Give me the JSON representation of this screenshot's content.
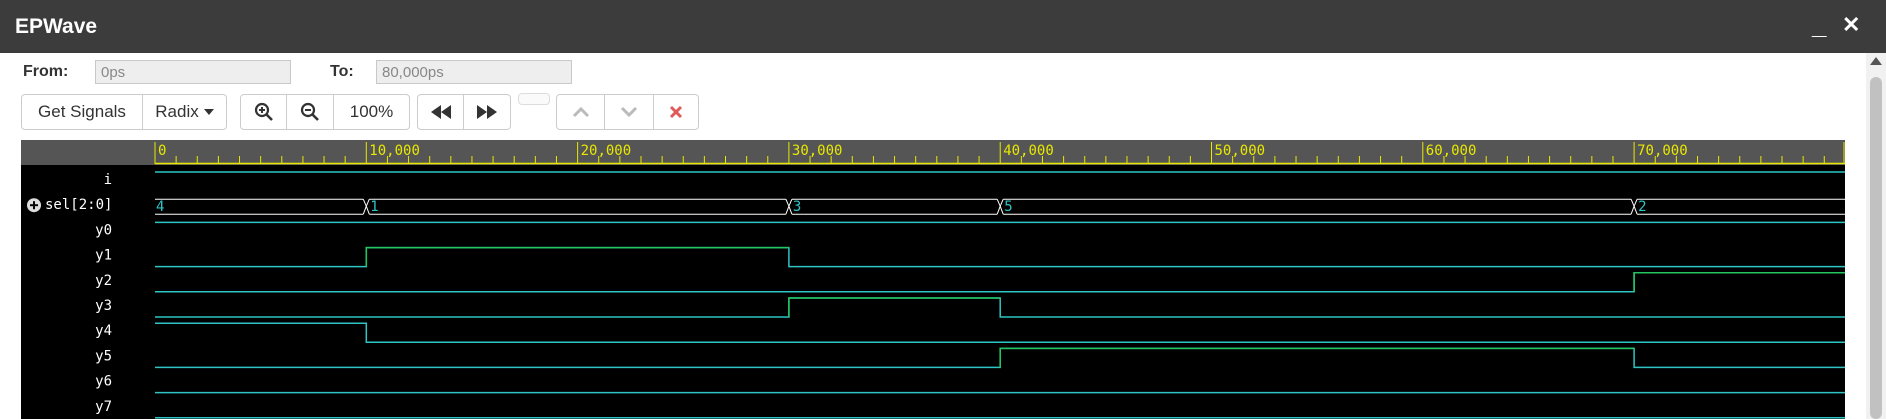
{
  "window": {
    "title": "EPWave",
    "minimize_label": "_",
    "close_label": "✕"
  },
  "range": {
    "from_label": "From:",
    "from_value": "0ps",
    "to_label": "To:",
    "to_value": "80,000ps"
  },
  "toolbar": {
    "get_signals": "Get Signals",
    "radix": "Radix",
    "zoom_in_icon": "zoom-in-icon",
    "zoom_out_icon": "zoom-out-icon",
    "zoom_level": "100%",
    "rewind_icon": "fast-backward-icon",
    "forward_icon": "fast-forward-icon",
    "prev_icon": "chevron-up-icon",
    "next_icon": "chevron-down-icon",
    "delete_icon": "times-icon"
  },
  "colors": {
    "signal": "#2ec4c4",
    "high_edge": "#22c55e",
    "ruler": "#e8e800",
    "bus": "#ffffff",
    "value": "#2ec4c4"
  },
  "ruler": {
    "ticks": [
      "0",
      "10,000",
      "20,000",
      "30,000",
      "40,000",
      "50,000",
      "60,000",
      "70,000"
    ]
  },
  "signals": [
    {
      "name": "i",
      "type": "bit",
      "changes": [
        [
          0,
          1
        ]
      ]
    },
    {
      "name": "sel[2:0]",
      "type": "bus",
      "expand_icon": "plus-circle-icon",
      "segments": [
        {
          "t": 0,
          "label": "4"
        },
        {
          "t": 10000,
          "label": "1"
        },
        {
          "t": 30000,
          "label": "3"
        },
        {
          "t": 40000,
          "label": "5"
        },
        {
          "t": 70000,
          "label": "2"
        }
      ]
    },
    {
      "name": "y0",
      "type": "bit",
      "changes": [
        [
          0,
          1
        ]
      ]
    },
    {
      "name": "y1",
      "type": "bit",
      "changes": [
        [
          0,
          0
        ],
        [
          10000,
          1
        ],
        [
          30000,
          0
        ]
      ]
    },
    {
      "name": "y2",
      "type": "bit",
      "changes": [
        [
          0,
          0
        ],
        [
          70000,
          1
        ]
      ]
    },
    {
      "name": "y3",
      "type": "bit",
      "changes": [
        [
          0,
          0
        ],
        [
          30000,
          1
        ],
        [
          40000,
          0
        ]
      ]
    },
    {
      "name": "y4",
      "type": "bit",
      "changes": [
        [
          0,
          1
        ],
        [
          10000,
          0
        ]
      ]
    },
    {
      "name": "y5",
      "type": "bit",
      "changes": [
        [
          0,
          0
        ],
        [
          40000,
          1
        ],
        [
          70000,
          0
        ]
      ]
    },
    {
      "name": "y6",
      "type": "bit",
      "changes": [
        [
          0,
          0
        ]
      ]
    },
    {
      "name": "y7",
      "type": "bit",
      "changes": [
        [
          0,
          0
        ]
      ]
    }
  ]
}
